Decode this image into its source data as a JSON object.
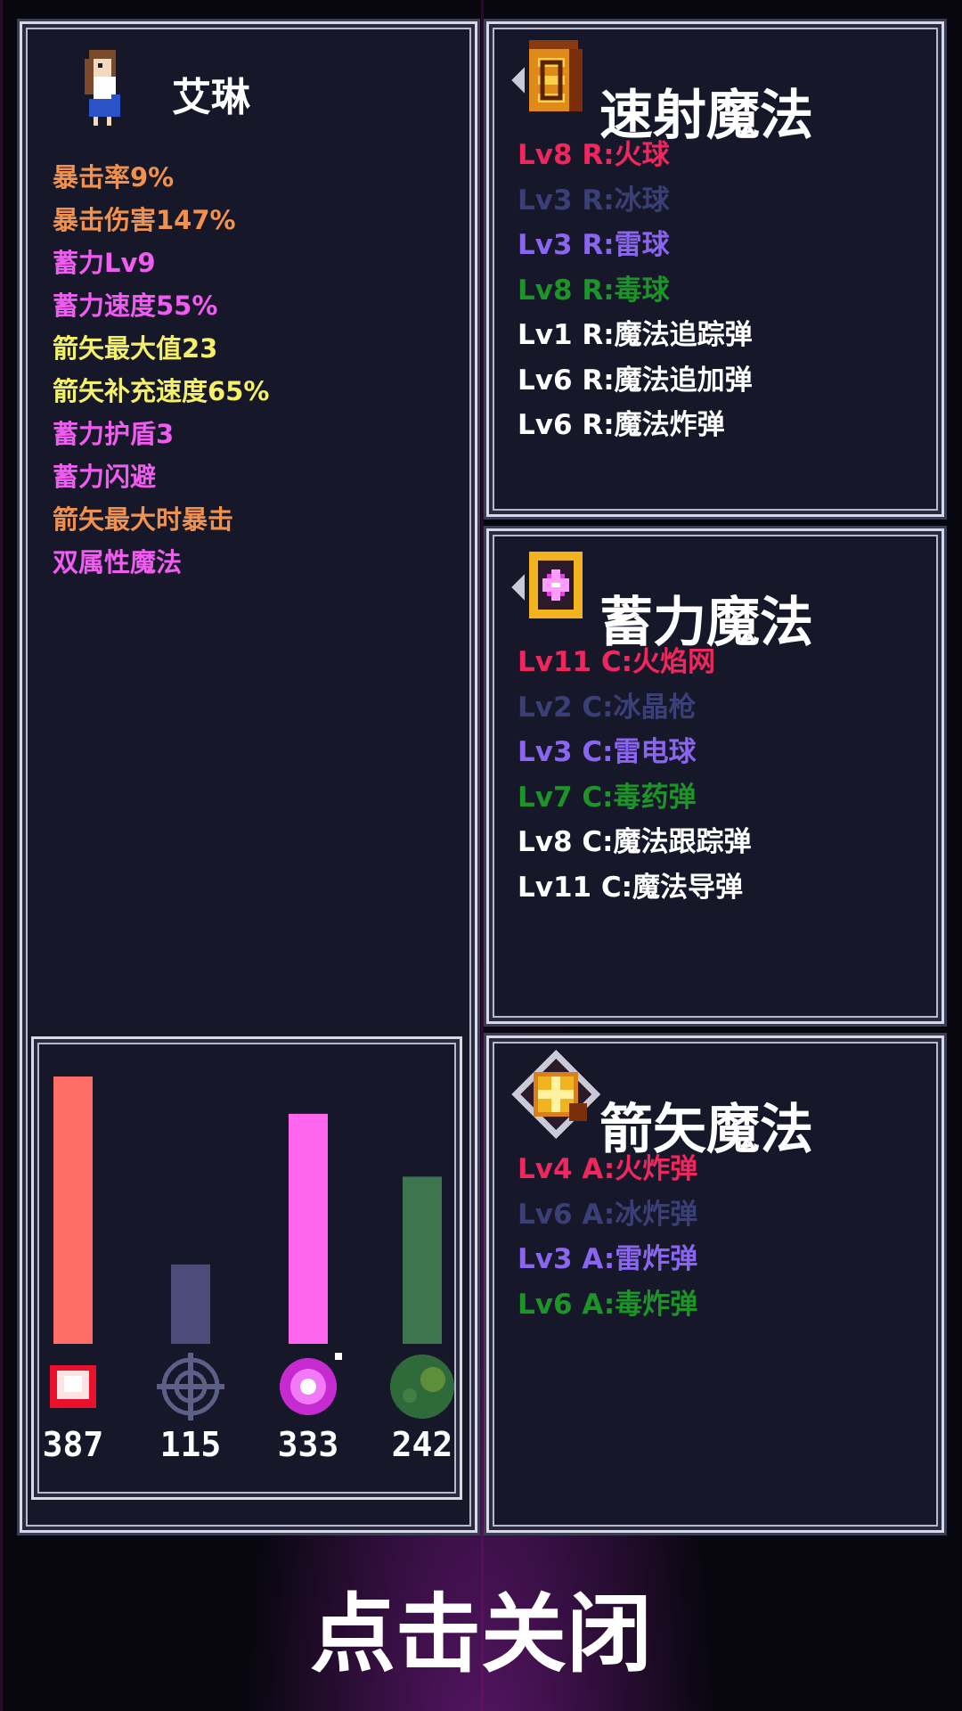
{
  "hero": {
    "name": "艾琳",
    "stats": [
      {
        "text": "暴击率9%",
        "color": "#f0924d"
      },
      {
        "text": "暴击伤害147%",
        "color": "#f0924d"
      },
      {
        "text": "蓄力Lv9",
        "color": "#f05bf0"
      },
      {
        "text": "蓄力速度55%",
        "color": "#f05bf0"
      },
      {
        "text": "箭矢最大值23",
        "color": "#f4f06a"
      },
      {
        "text": "箭矢补充速度65%",
        "color": "#f4f06a"
      },
      {
        "text": "蓄力护盾3",
        "color": "#f05bf0"
      },
      {
        "text": "蓄力闪避",
        "color": "#f05bf0"
      },
      {
        "text": "箭矢最大时暴击",
        "color": "#f0924d"
      },
      {
        "text": "双属性魔法",
        "color": "#f05bf0"
      }
    ]
  },
  "chart_data": {
    "type": "bar",
    "categories": [
      "fire",
      "ice",
      "thunder",
      "poison"
    ],
    "icons": [
      "fire-icon",
      "ice-icon",
      "thunder-icon",
      "poison-icon"
    ],
    "values": [
      387,
      115,
      333,
      242
    ],
    "value_labels": [
      "387",
      "115",
      "333",
      "242"
    ],
    "colors": [
      "#ff6e66",
      "#4b4c78",
      "#ff66f0",
      "#3c7550"
    ]
  },
  "rapid_magic": {
    "title": "速射魔法",
    "icon": "scroll-icon",
    "spells": [
      {
        "text": "Lv8 R:火球",
        "color": "#f0275d"
      },
      {
        "text": "Lv3 R:冰球",
        "color": "#3a3f78"
      },
      {
        "text": "Lv3 R:雷球",
        "color": "#8a65f0"
      },
      {
        "text": "Lv8 R:毒球",
        "color": "#1d9428"
      },
      {
        "text": "Lv1 R:魔法追踪弹",
        "color": "#ffffff"
      },
      {
        "text": "Lv6 R:魔法追加弹",
        "color": "#ffffff"
      },
      {
        "text": "Lv6 R:魔法炸弹",
        "color": "#ffffff"
      }
    ]
  },
  "charge_magic": {
    "title": "蓄力魔法",
    "icon": "charge-rune-icon",
    "spells": [
      {
        "text": "Lv11 C:火焰网",
        "color": "#f0275d"
      },
      {
        "text": "Lv2 C:冰晶枪",
        "color": "#3a3f78"
      },
      {
        "text": "Lv3 C:雷电球",
        "color": "#8a65f0"
      },
      {
        "text": "Lv7 C:毒药弹",
        "color": "#1d9428"
      },
      {
        "text": "Lv8 C:魔法跟踪弹",
        "color": "#ffffff"
      },
      {
        "text": "Lv11 C:魔法导弹",
        "color": "#ffffff"
      }
    ]
  },
  "arrow_magic": {
    "title": "箭矢魔法",
    "icon": "arrow-diamond-icon",
    "spells": [
      {
        "text": "Lv4 A:火炸弹",
        "color": "#f0275d"
      },
      {
        "text": "Lv6 A:冰炸弹",
        "color": "#3a3f78"
      },
      {
        "text": "Lv3 A:雷炸弹",
        "color": "#8a65f0"
      },
      {
        "text": "Lv6 A:毒炸弹",
        "color": "#1d9428"
      }
    ]
  },
  "close_button": {
    "label": "点击关闭"
  }
}
